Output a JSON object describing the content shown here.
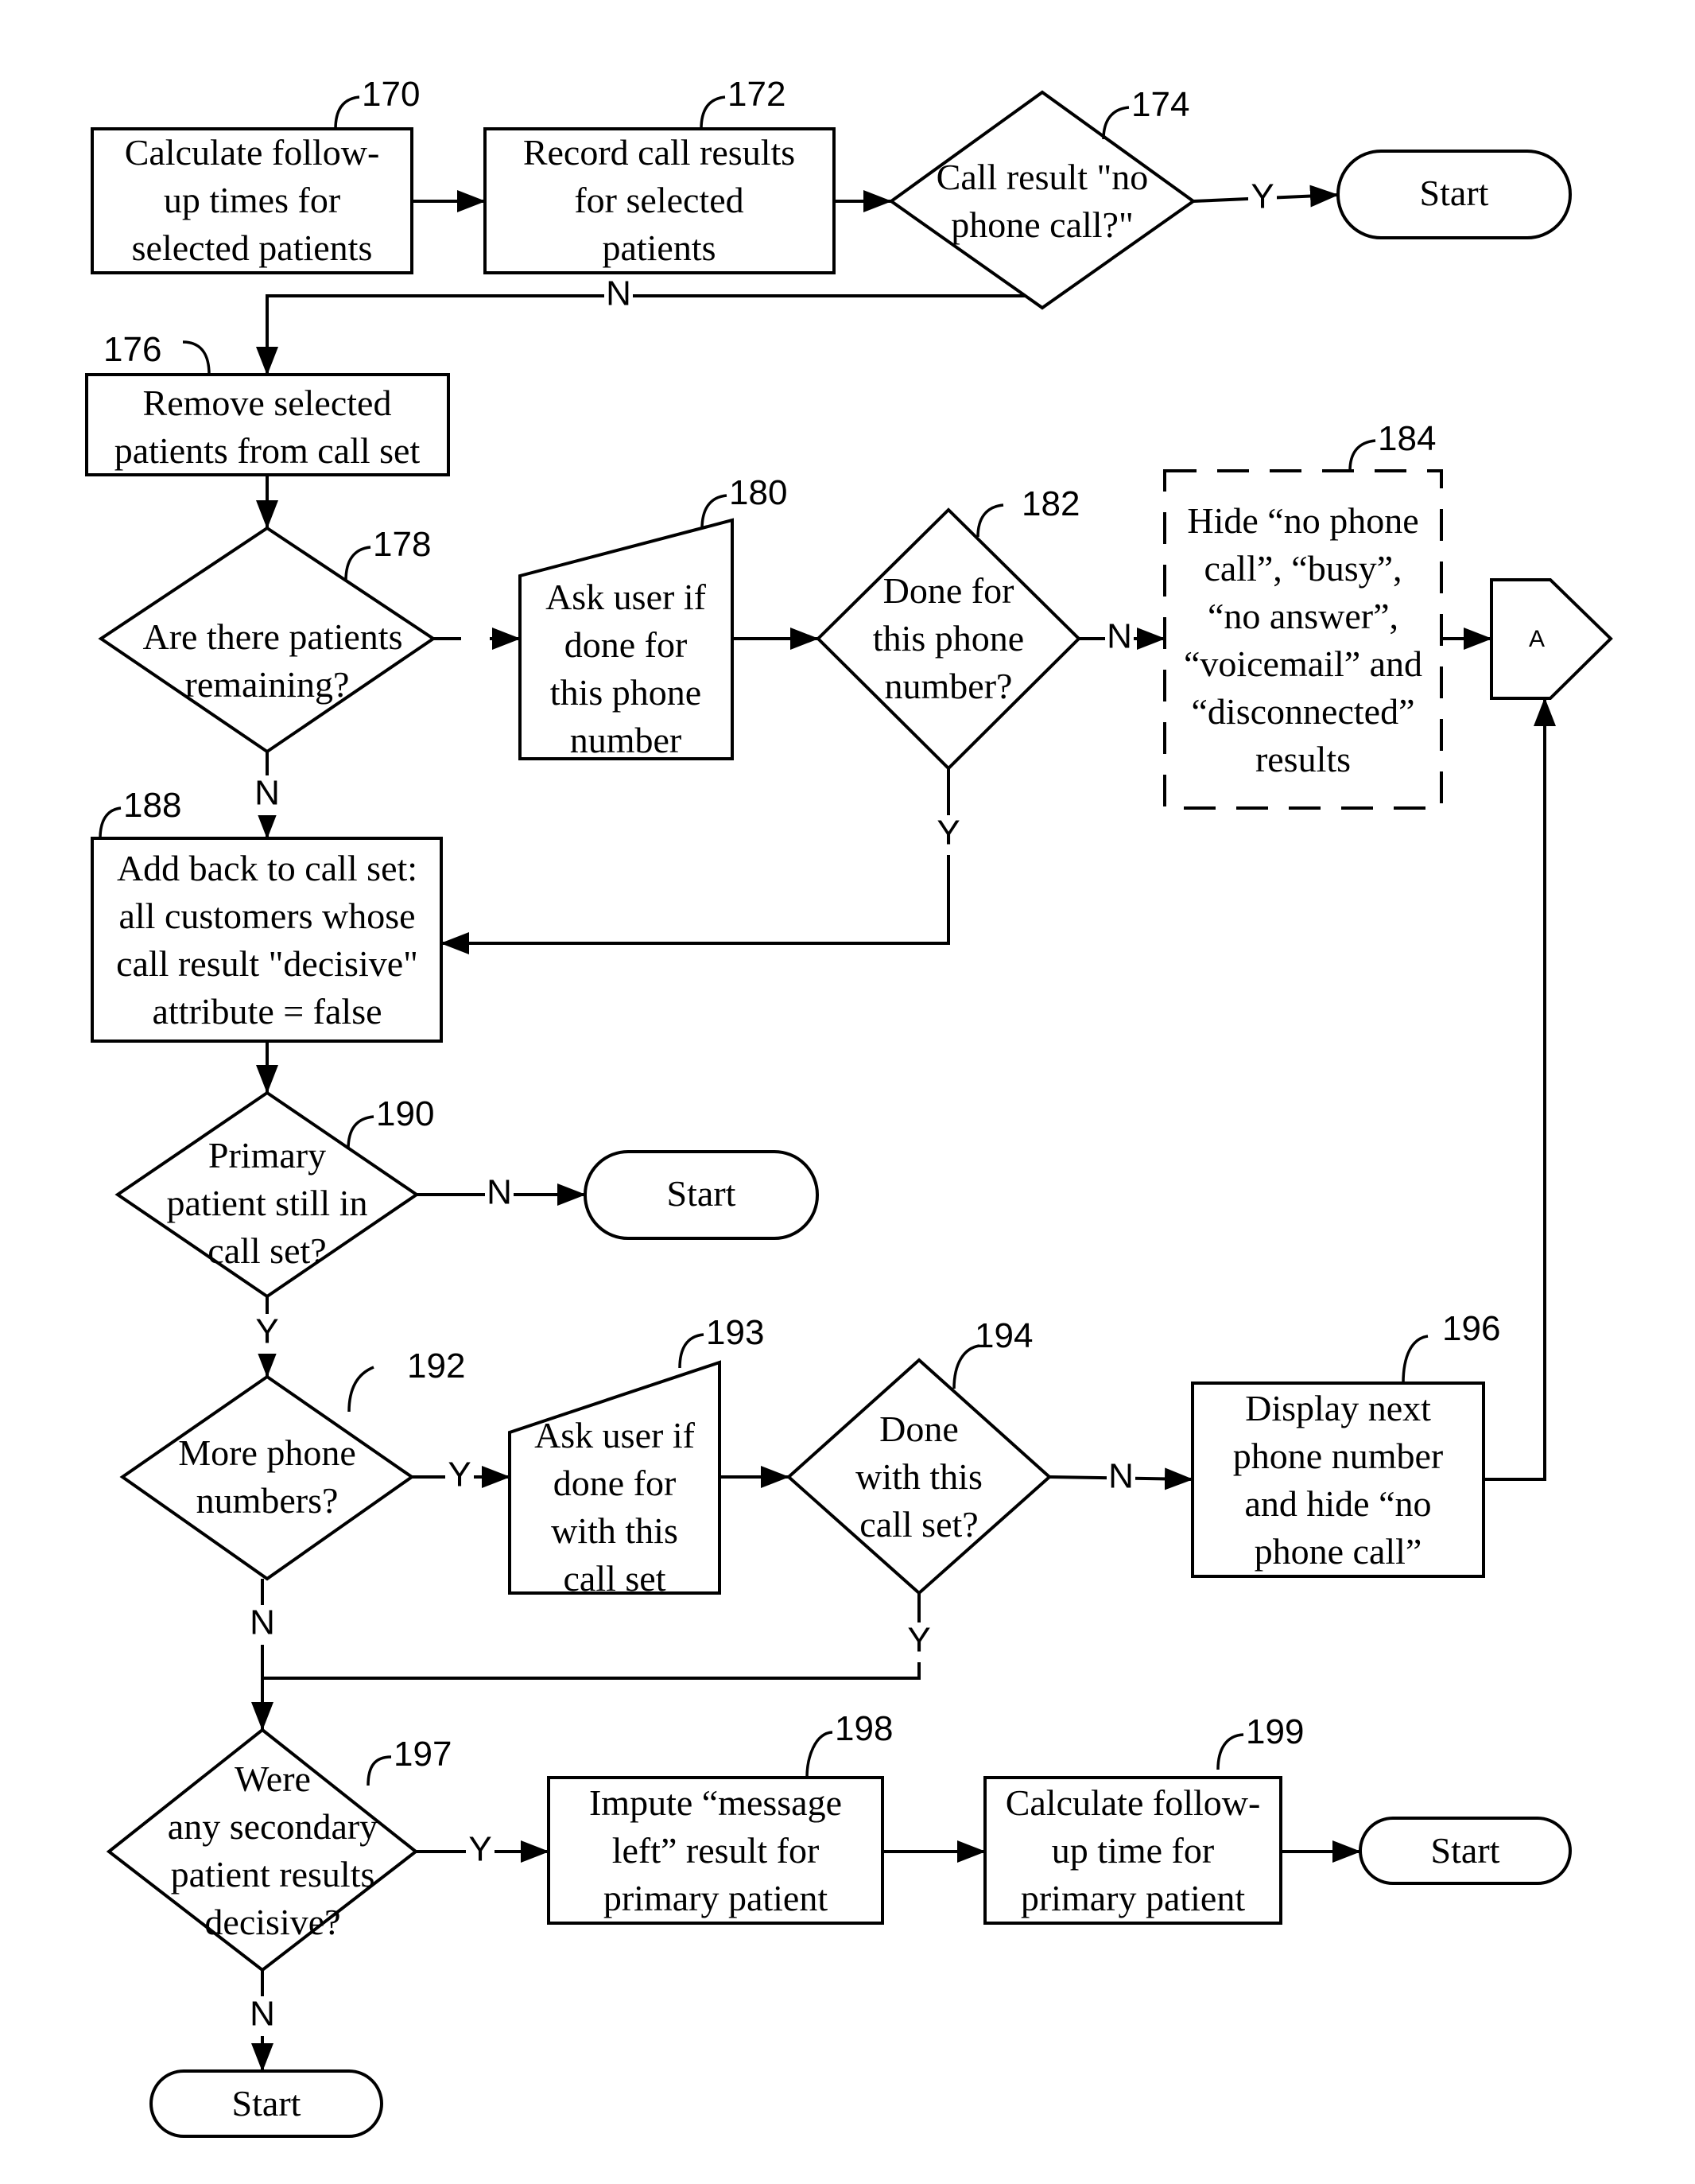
{
  "diagram": {
    "type": "flowchart",
    "nodes": {
      "n170": {
        "ref": "170",
        "shape": "process",
        "lines": [
          "Calculate follow-",
          "up times for",
          "selected patients"
        ]
      },
      "n172": {
        "ref": "172",
        "shape": "process",
        "lines": [
          "Record call results",
          "for selected",
          "patients"
        ]
      },
      "n174": {
        "ref": "174",
        "shape": "decision",
        "lines": [
          "Call result \"no",
          "phone call?\""
        ]
      },
      "start1": {
        "shape": "terminator",
        "lines": [
          "Start"
        ]
      },
      "n176": {
        "ref": "176",
        "shape": "process",
        "lines": [
          "Remove selected",
          "patients from call set"
        ]
      },
      "n178": {
        "ref": "178",
        "shape": "decision",
        "lines": [
          "Are there patients",
          "remaining?"
        ]
      },
      "n180": {
        "ref": "180",
        "shape": "manual-input",
        "lines": [
          "Ask user if",
          "done for",
          "this phone",
          "number"
        ]
      },
      "n182": {
        "ref": "182",
        "shape": "decision",
        "lines": [
          "Done for",
          "this phone",
          "number?"
        ]
      },
      "n184": {
        "ref": "184",
        "shape": "optional-process",
        "lines": [
          "Hide “no phone",
          "call”, “busy”,",
          "“no answer”,",
          "“voicemail” and",
          "“disconnected”",
          "results"
        ]
      },
      "connA": {
        "shape": "off-page-connector",
        "lines": [
          "A"
        ]
      },
      "n188": {
        "ref": "188",
        "shape": "process",
        "lines": [
          "Add back to call set:",
          "all customers whose",
          "call result \"decisive\"",
          "attribute = false"
        ]
      },
      "n190": {
        "ref": "190",
        "shape": "decision",
        "lines": [
          "Primary",
          "patient still in",
          "call set?"
        ]
      },
      "start2": {
        "shape": "terminator",
        "lines": [
          "Start"
        ]
      },
      "n192": {
        "ref": "192",
        "shape": "decision",
        "lines": [
          "More phone",
          "numbers?"
        ]
      },
      "n193": {
        "ref": "193",
        "shape": "manual-input",
        "lines": [
          "Ask user if",
          "done for",
          "with this",
          "call set"
        ]
      },
      "n194": {
        "ref": "194",
        "shape": "decision",
        "lines": [
          "Done",
          "with this",
          "call set?"
        ]
      },
      "n196": {
        "ref": "196",
        "shape": "process",
        "lines": [
          "Display next",
          "phone number",
          "and hide “no",
          "phone call”"
        ]
      },
      "n197": {
        "ref": "197",
        "shape": "decision",
        "lines": [
          "Were",
          "any secondary",
          "patient results",
          "decisive?"
        ]
      },
      "n198": {
        "ref": "198",
        "shape": "process",
        "lines": [
          "Impute “message",
          "left” result for",
          "primary patient"
        ]
      },
      "n199": {
        "ref": "199",
        "shape": "process",
        "lines": [
          "Calculate follow-",
          "up time for",
          "primary patient"
        ]
      },
      "start3": {
        "shape": "terminator",
        "lines": [
          "Start"
        ]
      },
      "start4": {
        "shape": "terminator",
        "lines": [
          "Start"
        ]
      }
    },
    "edges": [
      {
        "from": "n170",
        "to": "n172",
        "label": ""
      },
      {
        "from": "n172",
        "to": "n174",
        "label": ""
      },
      {
        "from": "n174",
        "to": "start1",
        "label": "Y"
      },
      {
        "from": "n174",
        "to": "n176",
        "label": "N"
      },
      {
        "from": "n176",
        "to": "n178",
        "label": ""
      },
      {
        "from": "n178",
        "to": "n180",
        "label": "Y"
      },
      {
        "from": "n178",
        "to": "n188",
        "label": "N"
      },
      {
        "from": "n180",
        "to": "n182",
        "label": ""
      },
      {
        "from": "n182",
        "to": "n184",
        "label": "N"
      },
      {
        "from": "n182",
        "to": "n188",
        "label": "Y"
      },
      {
        "from": "n184",
        "to": "connA",
        "label": ""
      },
      {
        "from": "n188",
        "to": "n190",
        "label": ""
      },
      {
        "from": "n190",
        "to": "start2",
        "label": "N"
      },
      {
        "from": "n190",
        "to": "n192",
        "label": "Y"
      },
      {
        "from": "n192",
        "to": "n193",
        "label": "Y"
      },
      {
        "from": "n192",
        "to": "n197",
        "label": "N"
      },
      {
        "from": "n193",
        "to": "n194",
        "label": ""
      },
      {
        "from": "n194",
        "to": "n196",
        "label": "N"
      },
      {
        "from": "n194",
        "to": "n197",
        "label": "Y"
      },
      {
        "from": "n196",
        "to": "connA",
        "label": ""
      },
      {
        "from": "n197",
        "to": "n198",
        "label": "Y"
      },
      {
        "from": "n197",
        "to": "start4",
        "label": "N"
      },
      {
        "from": "n198",
        "to": "n199",
        "label": ""
      },
      {
        "from": "n199",
        "to": "start3",
        "label": ""
      }
    ]
  }
}
